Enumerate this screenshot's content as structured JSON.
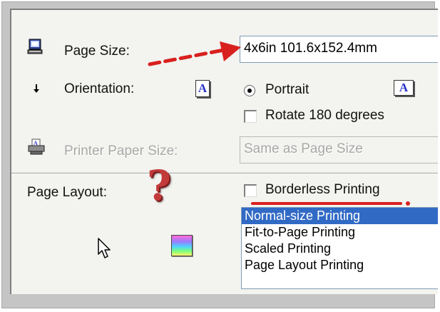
{
  "page_size": {
    "label": "Page Size:",
    "value": "4x6in 101.6x152.4mm"
  },
  "orientation": {
    "label": "Orientation:",
    "icon_letter": "A",
    "portrait_label": "Portrait",
    "portrait_icon_letter": "A",
    "rotate_label": "Rotate 180 degrees"
  },
  "printer_paper_size": {
    "label": "Printer Paper Size:",
    "value": "Same as Page Size"
  },
  "page_layout": {
    "label": "Page Layout:",
    "question_mark": "?",
    "borderless_label": "Borderless Printing",
    "options": [
      "Normal-size Printing",
      "Fit-to-Page Printing",
      "Scaled Printing",
      "Page Layout Printing"
    ],
    "selected_index": 0
  },
  "colors": {
    "annotation_red": "#d8201e",
    "selection_blue": "#316ac5"
  }
}
